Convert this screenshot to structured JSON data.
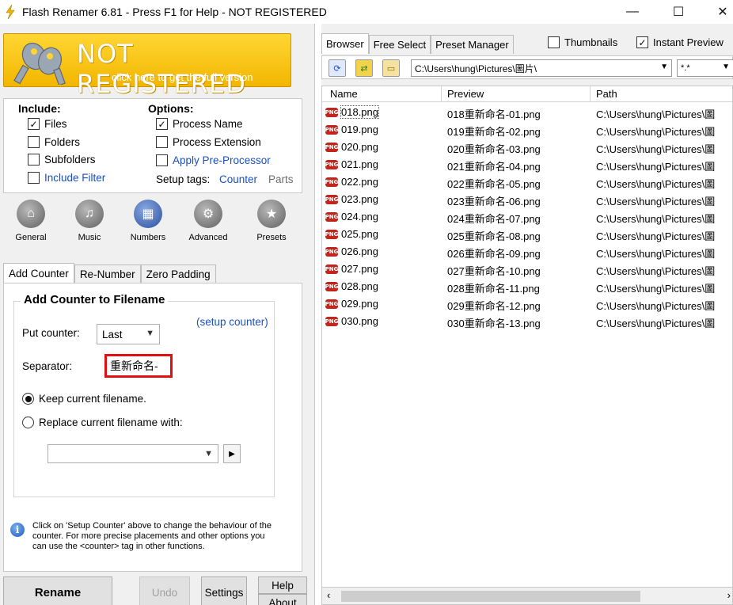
{
  "window": {
    "title": "Flash Renamer 6.81 - Press F1 for Help - NOT REGISTERED",
    "minimize": "—",
    "maximize": "☐",
    "close": "✕"
  },
  "banner": {
    "title": "NOT REGISTERED",
    "subtitle": "click here to get the full version"
  },
  "include": {
    "header": "Include:",
    "items": [
      {
        "label": "Files",
        "checked": true
      },
      {
        "label": "Folders",
        "checked": false
      },
      {
        "label": "Subfolders",
        "checked": false
      },
      {
        "label": "Include Filter",
        "checked": false
      }
    ]
  },
  "options": {
    "header": "Options:",
    "items": [
      {
        "label": "Process Name",
        "checked": true
      },
      {
        "label": "Process Extension",
        "checked": false
      },
      {
        "label": "Apply Pre-Processor",
        "checked": false
      }
    ],
    "setup_tags_label": "Setup tags:",
    "counter_link": "Counter",
    "parts_link": "Parts"
  },
  "categories": [
    {
      "label": "General",
      "icon": "home-icon",
      "glyph": "⌂"
    },
    {
      "label": "Music",
      "icon": "music-icon",
      "glyph": "♫"
    },
    {
      "label": "Numbers",
      "icon": "calculator-icon",
      "glyph": "▦"
    },
    {
      "label": "Advanced",
      "icon": "gear-icon",
      "glyph": "⚙"
    },
    {
      "label": "Presets",
      "icon": "star-icon",
      "glyph": "★"
    }
  ],
  "sub_tabs": [
    "Add Counter",
    "Re-Number",
    "Zero Padding"
  ],
  "add_counter": {
    "group_title": "Add Counter to Filename",
    "setup_link": "(setup counter)",
    "put_counter_label": "Put counter:",
    "put_counter_value": "Last",
    "separator_label": "Separator:",
    "separator_value": "重新命名-",
    "keep_label": "Keep current filename.",
    "replace_label": "Replace current filename with:",
    "replace_value": "",
    "info_text": "Click on 'Setup Counter' above to change the behaviour of the counter. For more precise placements and other options you can use the <counter> tag in other functions."
  },
  "buttons": {
    "rename": "Rename",
    "undo": "Undo",
    "settings": "Settings",
    "help": "Help",
    "about": "About"
  },
  "browser": {
    "tabs": [
      "Browser",
      "Free Select",
      "Preset Manager"
    ],
    "thumbnails_label": "Thumbnails",
    "thumbnails_checked": false,
    "instant_preview_label": "Instant Preview",
    "instant_preview_checked": true,
    "path": "C:\\Users\\hung\\Pictures\\圖片\\",
    "mask": "*.*",
    "columns": [
      "Name",
      "Preview",
      "Path"
    ],
    "files": [
      {
        "name": "018.png",
        "preview": "018重新命名-01.png",
        "path": "C:\\Users\\hung\\Pictures\\圖"
      },
      {
        "name": "019.png",
        "preview": "019重新命名-02.png",
        "path": "C:\\Users\\hung\\Pictures\\圖"
      },
      {
        "name": "020.png",
        "preview": "020重新命名-03.png",
        "path": "C:\\Users\\hung\\Pictures\\圖"
      },
      {
        "name": "021.png",
        "preview": "021重新命名-04.png",
        "path": "C:\\Users\\hung\\Pictures\\圖"
      },
      {
        "name": "022.png",
        "preview": "022重新命名-05.png",
        "path": "C:\\Users\\hung\\Pictures\\圖"
      },
      {
        "name": "023.png",
        "preview": "023重新命名-06.png",
        "path": "C:\\Users\\hung\\Pictures\\圖"
      },
      {
        "name": "024.png",
        "preview": "024重新命名-07.png",
        "path": "C:\\Users\\hung\\Pictures\\圖"
      },
      {
        "name": "025.png",
        "preview": "025重新命名-08.png",
        "path": "C:\\Users\\hung\\Pictures\\圖"
      },
      {
        "name": "026.png",
        "preview": "026重新命名-09.png",
        "path": "C:\\Users\\hung\\Pictures\\圖"
      },
      {
        "name": "027.png",
        "preview": "027重新命名-10.png",
        "path": "C:\\Users\\hung\\Pictures\\圖"
      },
      {
        "name": "028.png",
        "preview": "028重新命名-11.png",
        "path": "C:\\Users\\hung\\Pictures\\圖"
      },
      {
        "name": "029.png",
        "preview": "029重新命名-12.png",
        "path": "C:\\Users\\hung\\Pictures\\圖"
      },
      {
        "name": "030.png",
        "preview": "030重新命名-13.png",
        "path": "C:\\Users\\hung\\Pictures\\圖"
      }
    ],
    "file_badge": "PNG"
  },
  "colors": {
    "banner": "#f2b600",
    "link": "#1a4fc4",
    "separator_highlight": "#e01010",
    "file_badge": "#c0261c"
  }
}
